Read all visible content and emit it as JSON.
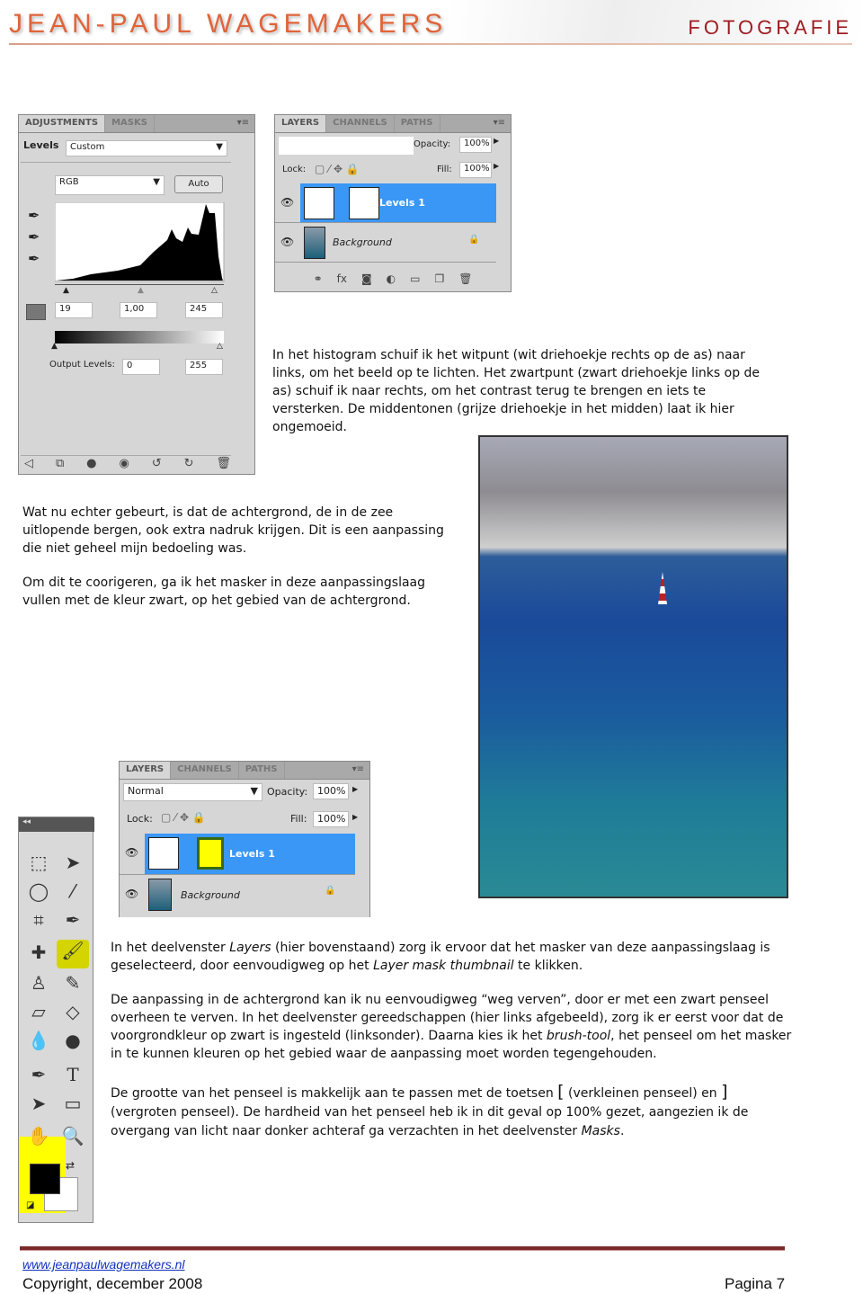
{
  "header": {
    "name": "Jean-Paul Wagemakers",
    "tagline": "Fotografie"
  },
  "adjustments": {
    "tabs": [
      "ADJUSTMENTS",
      "MASKS"
    ],
    "title": "Levels",
    "preset": "Custom",
    "channel": "RGB",
    "auto": "Auto",
    "input_black": "19",
    "input_gamma": "1,00",
    "input_white": "245",
    "output_label": "Output Levels:",
    "output_black": "0",
    "output_white": "255"
  },
  "layers1": {
    "tabs": [
      "LAYERS",
      "CHANNELS",
      "PATHS"
    ],
    "blend": "",
    "opacity_label": "Opacity:",
    "opacity": "100%",
    "lock_label": "Lock:",
    "fill_label": "Fill:",
    "fill": "100%",
    "layers": [
      {
        "name": "Levels 1",
        "selected": true
      },
      {
        "name": "Background",
        "selected": false
      }
    ]
  },
  "layers2": {
    "tabs": [
      "LAYERS",
      "CHANNELS",
      "PATHS"
    ],
    "blend": "Normal",
    "opacity_label": "Opacity:",
    "opacity": "100%",
    "lock_label": "Lock:",
    "fill_label": "Fill:",
    "fill": "100%",
    "layers": [
      {
        "name": "Levels 1",
        "selected": true
      },
      {
        "name": "Background",
        "selected": false
      }
    ],
    "mask_color": "#ffff00"
  },
  "text": {
    "p1": "In het histogram schuif ik het witpunt (wit driehoekje rechts op de as) naar links, om het beeld op te lichten. Het zwartpunt (zwart driehoekje links op de as) schuif ik naar rechts, om het contrast terug te brengen en iets te versterken. De middentonen (grijze driehoekje in het midden) laat ik hier ongemoeid.",
    "p2": "Wat nu echter gebeurt, is dat de achtergrond, de in de zee uitlopende bergen, ook extra nadruk krijgen. Dit is een aanpassing die niet geheel mijn bedoeling was.",
    "p3": "Om dit te coorigeren, ga ik het masker in deze aanpassingslaag vullen met de kleur zwart, op het gebied van de achtergrond.",
    "p4": [
      "In het deelvenster ",
      "Layers",
      " (hier bovenstaand) zorg ik ervoor dat het masker van deze aanpassingslaag is geselecteerd, door eenvoudigweg op het ",
      "Layer mask thumbnail",
      " te klikken."
    ],
    "p5": [
      "De aanpassing in de achtergrond kan ik nu eenvoudigweg “weg verven”, door er met een zwart penseel overheen te verven. In het deelvenster gereedschappen (hier links afgebeeld), zorg ik er eerst voor dat de voorgrondkleur op zwart is ingesteld (linksonder). Daarna kies ik het ",
      "brush-tool",
      ", het penseel om het masker in te kunnen kleuren op het gebied waar de aanpassing moet worden tegengehouden."
    ],
    "p6": [
      "De grootte van het penseel is makkelijk aan te passen met de toetsen ",
      "[",
      " (verkleinen penseel) en ",
      "]",
      " (vergroten penseel). De hardheid van het penseel heb ik in dit geval op 100% gezet, aangezien ik de overgang van licht naar donker achteraf ga verzachten in het deelvenster ",
      "Masks",
      "."
    ]
  },
  "footer": {
    "link": "www.jeanpaulwagemakers.nl",
    "copyright": "Copyright, december 2008",
    "page": "Pagina 7",
    "rule_color": "#7a2a2a"
  }
}
